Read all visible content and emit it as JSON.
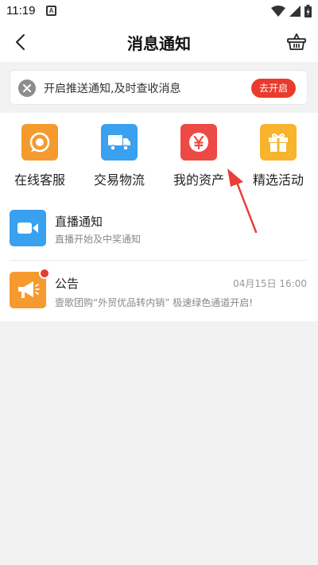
{
  "status_bar": {
    "time": "11:19",
    "indicator": "A",
    "icons": [
      "wifi-icon",
      "signal-icon",
      "battery-icon"
    ]
  },
  "header": {
    "title": "消息通知",
    "back_icon": "chevron-left-icon",
    "right_icon": "basket-icon"
  },
  "push_banner": {
    "text": "开启推送通知,及时查收消息",
    "button_label": "去开启",
    "close_icon": "close-icon",
    "button_color": "#e83b2d"
  },
  "quick_actions": [
    {
      "label": "在线客服",
      "icon": "headset-icon",
      "color": "#f59a2e"
    },
    {
      "label": "交易物流",
      "icon": "truck-icon",
      "color": "#3aa0f0"
    },
    {
      "label": "我的资产",
      "icon": "yen-icon",
      "color": "#ee4a45"
    },
    {
      "label": "精选活动",
      "icon": "gift-icon",
      "color": "#f8b42c"
    }
  ],
  "messages": [
    {
      "title": "直播通知",
      "subtitle": "直播开始及中奖通知",
      "time": "",
      "icon": "video-camera-icon",
      "color": "#3aa0f0",
      "unread": false
    },
    {
      "title": "公告",
      "subtitle": "壹歌团购“外贸优品转内销” 极速绿色通道开启!",
      "time": "04月15日 16:00",
      "icon": "megaphone-icon",
      "color": "#f59a2e",
      "unread": true
    }
  ]
}
